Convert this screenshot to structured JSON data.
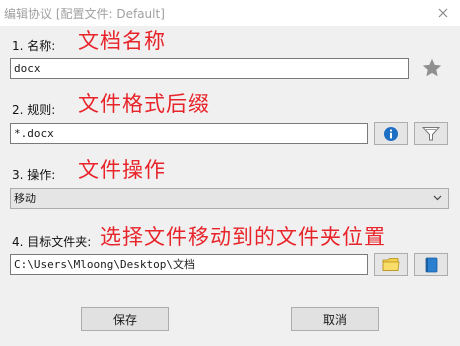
{
  "window": {
    "title": "编辑协议 [配置文件: Default]"
  },
  "name_section": {
    "label": "1. 名称:",
    "annotation": "文档名称",
    "value": "docx",
    "favorite_icon": "star-icon"
  },
  "rule_section": {
    "label": "2. 规则:",
    "annotation": "文件格式后缀",
    "value": "*.docx",
    "info_icon": "info-icon",
    "filter_icon": "filter-icon"
  },
  "action_section": {
    "label": "3. 操作:",
    "annotation": "文件操作",
    "selected": "移动"
  },
  "target_section": {
    "label": "4. 目标文件夹:",
    "annotation": "选择文件移动到的文件夹位置",
    "value": "C:\\Users\\Mloong\\Desktop\\文档",
    "folder_icon": "folder-icon",
    "book_icon": "book-icon"
  },
  "buttons": {
    "save": "保存",
    "cancel": "取消"
  },
  "colors": {
    "annotation": "#e8242a",
    "background": "#f0f0f0",
    "title_text": "#a0a0a0"
  }
}
